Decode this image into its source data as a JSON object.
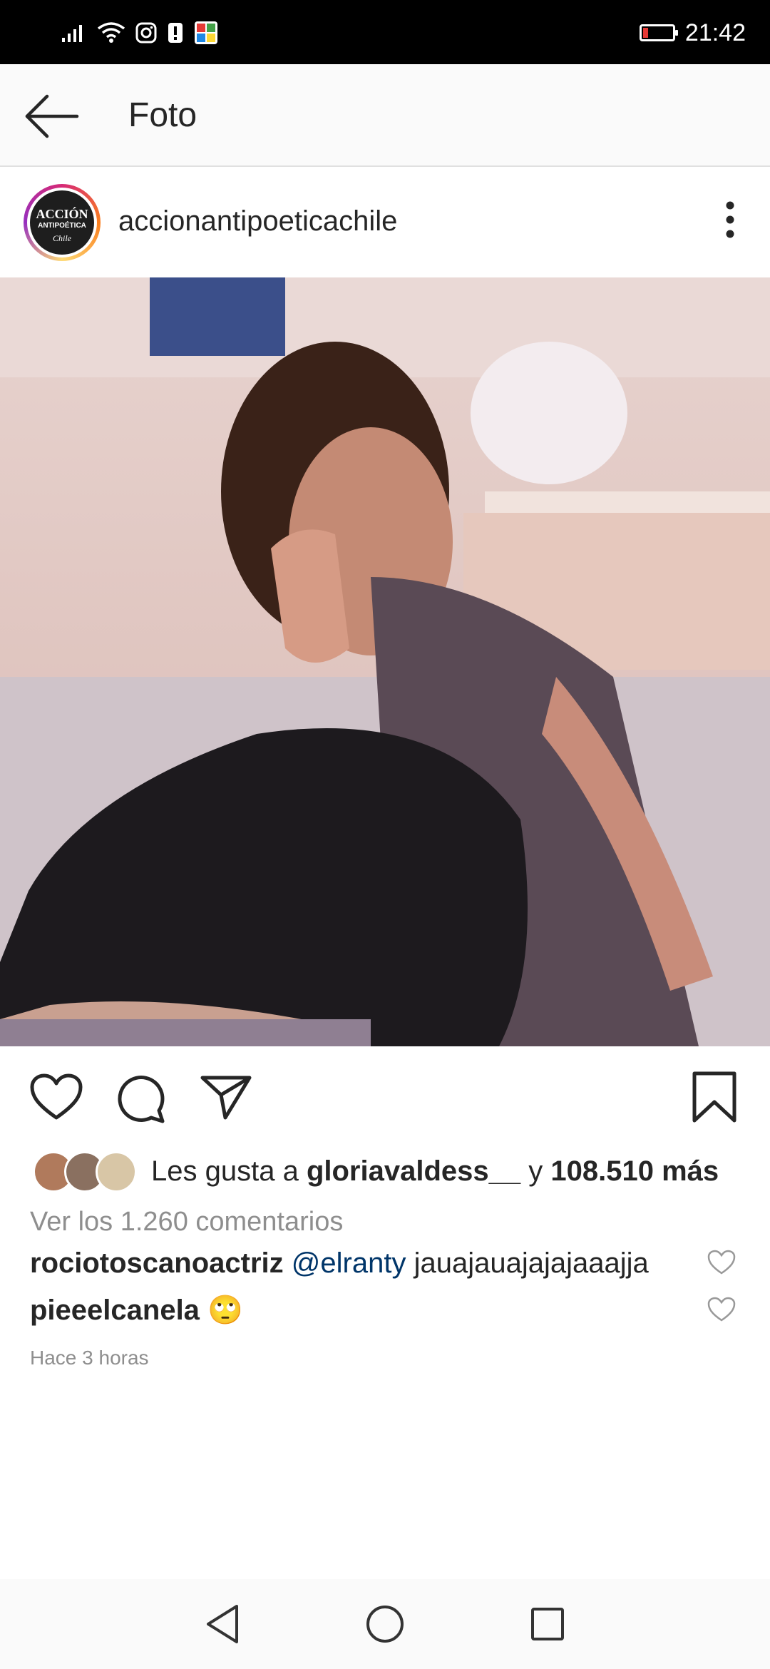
{
  "status_bar": {
    "time": "21:42",
    "icons": [
      "signal-icon",
      "wifi-icon",
      "instagram-icon",
      "alert-icon",
      "notification-app-icon",
      "battery-low-icon"
    ]
  },
  "app_bar": {
    "title": "Foto",
    "back_icon": "arrow-left-icon"
  },
  "post": {
    "username": "accionantipoeticachile",
    "avatar_text": {
      "line1": "ACCIÓN",
      "line2": "ANTIPOÉTICA",
      "line3": "Chile"
    },
    "more_icon": "vertical-dots-icon",
    "image_alt": "post-photo"
  },
  "actions": {
    "icons": [
      "heart-icon",
      "comment-icon",
      "share-icon",
      "bookmark-icon"
    ]
  },
  "likes": {
    "prefix": "Les gusta a ",
    "user": "gloriavaldess__",
    "middle": " y ",
    "count": "108.510 más"
  },
  "view_comments": "Ver los 1.260 comentarios",
  "comments": [
    {
      "user": "rociotoscanoactriz",
      "mention": "@elranty",
      "text": " jauajauajajajaaajja"
    },
    {
      "user": "pieeelcanela",
      "mention": "",
      "text": " 🙄"
    }
  ],
  "timestamp": "Hace 3 horas",
  "nav": {
    "icons": [
      "triangle-back-icon",
      "circle-home-icon",
      "square-recents-icon"
    ]
  },
  "colors": {
    "status_bar": "#000000",
    "app_bar": "#fafafa",
    "text": "#262626",
    "secondary_text": "#8e8e8e",
    "mention": "#003569",
    "battery_low": "#e53935"
  }
}
